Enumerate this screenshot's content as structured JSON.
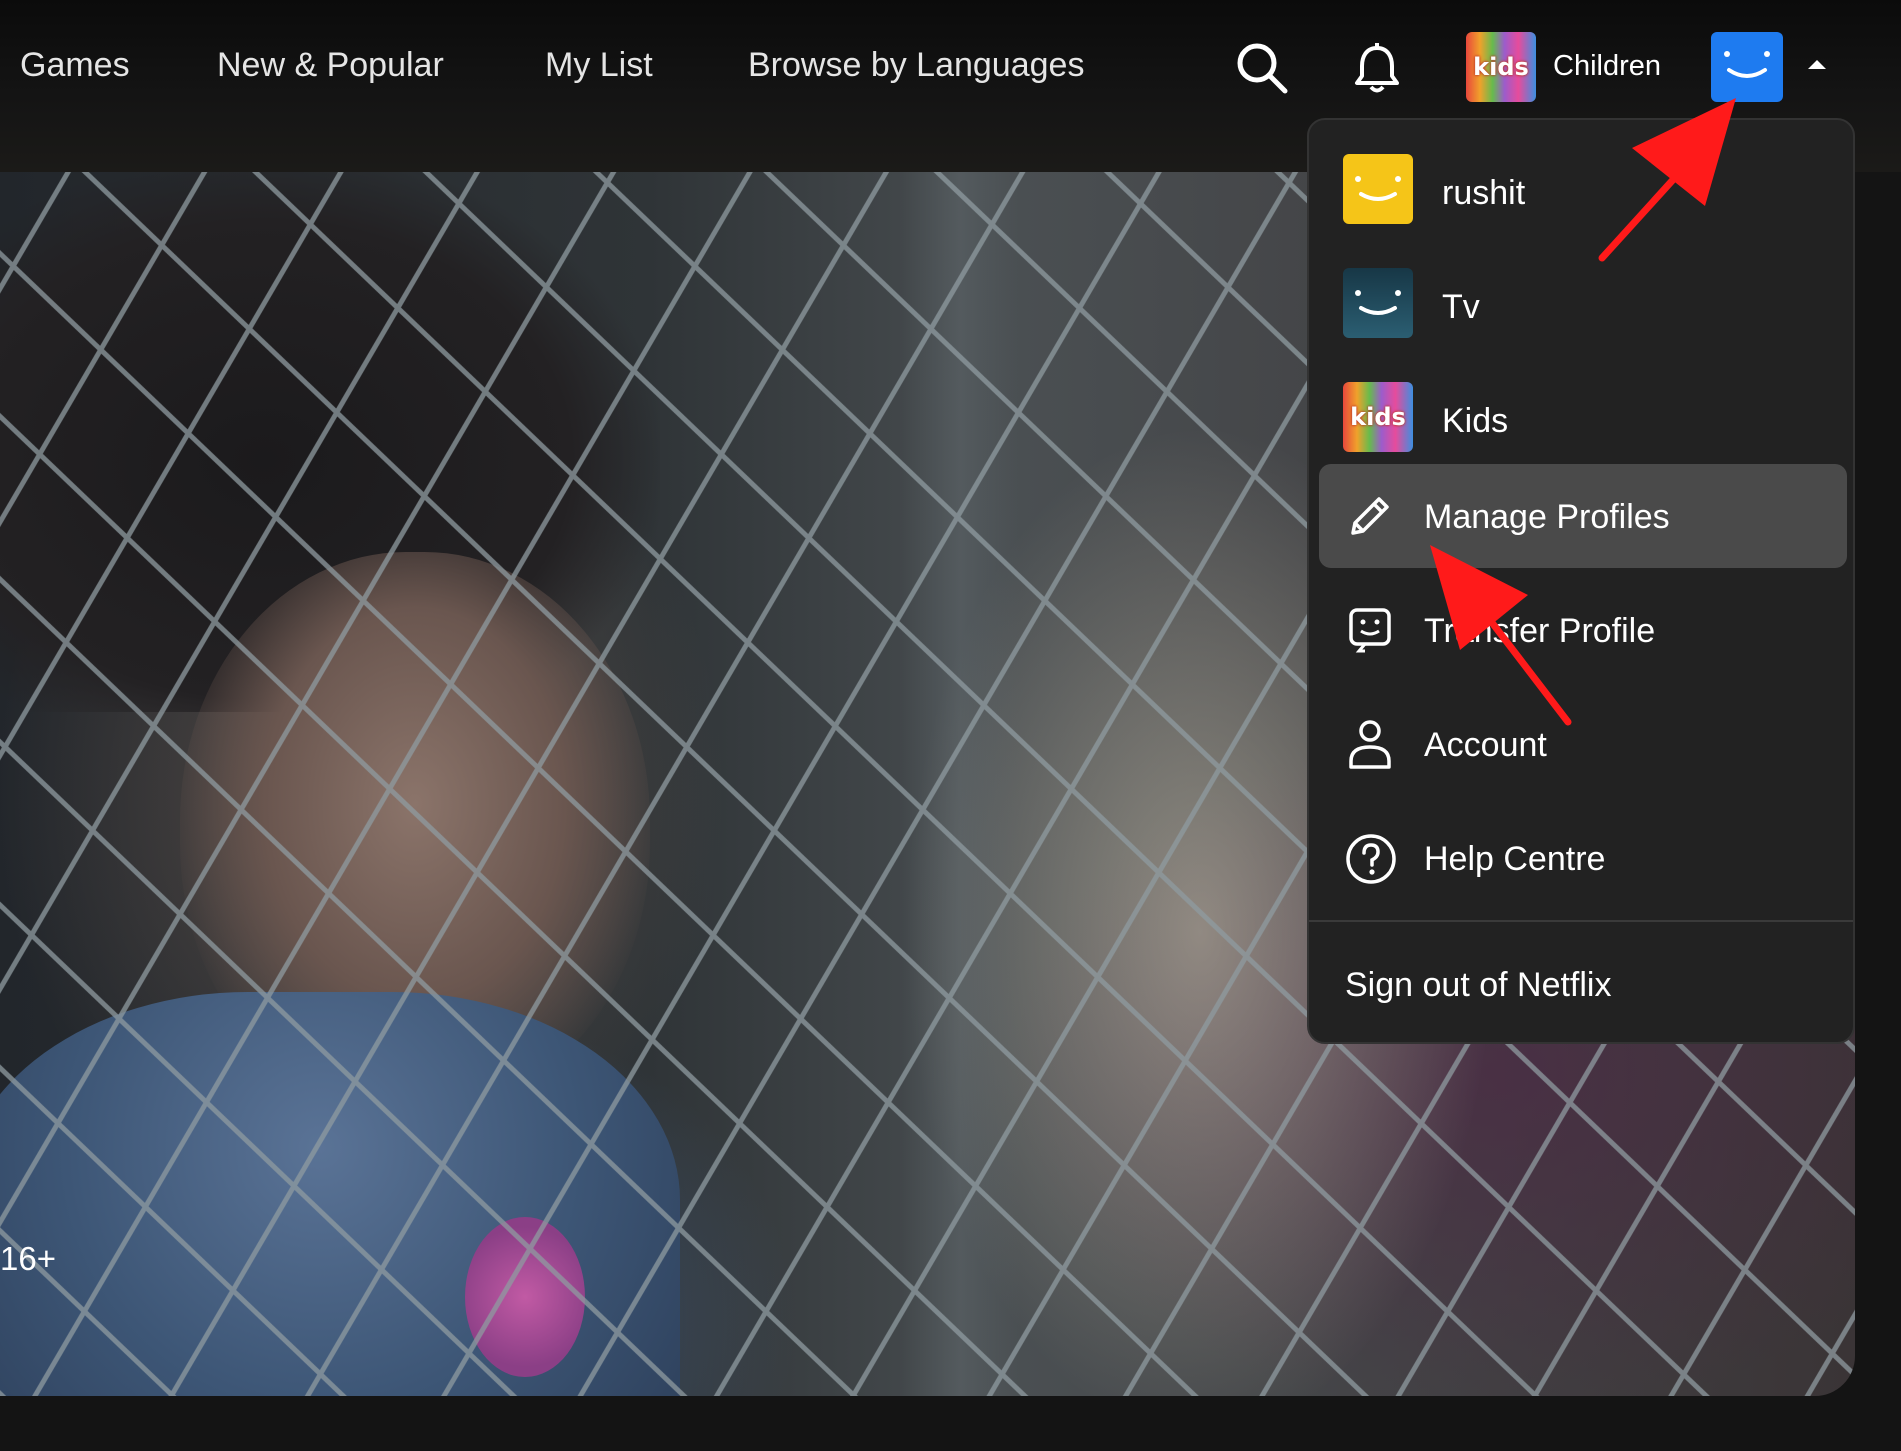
{
  "nav": {
    "items": [
      "Games",
      "New & Popular",
      "My List",
      "Browse by Languages"
    ],
    "search_icon": "search-icon",
    "bell_icon": "bell-icon",
    "kids_badge_text": "kids",
    "kids_link_label": "Children",
    "current_profile_icon": "smiley-icon",
    "caret_icon": "caret-up-icon"
  },
  "dropdown": {
    "profiles": [
      {
        "name": "rushit",
        "avatar_color": "#f5c518"
      },
      {
        "name": "Tv",
        "avatar_color": "#1f4a5c"
      },
      {
        "name": "Kids",
        "avatar_text": "kids"
      }
    ],
    "menu": [
      {
        "label": "Manage Profiles",
        "icon": "pencil-icon",
        "highlighted": true
      },
      {
        "label": "Transfer Profile",
        "icon": "transfer-profile-icon"
      },
      {
        "label": "Account",
        "icon": "person-icon"
      },
      {
        "label": "Help Centre",
        "icon": "help-icon"
      }
    ],
    "sign_out_label": "Sign out of Netflix"
  },
  "hero": {
    "maturity_rating": "16+"
  },
  "colors": {
    "page_bg": "#141414",
    "menu_bg": "#222222",
    "highlight_bg": "#4a4a4a",
    "annotation_arrow": "#ff1a1a",
    "profile_avatar_blue": "#1e7bf0"
  }
}
